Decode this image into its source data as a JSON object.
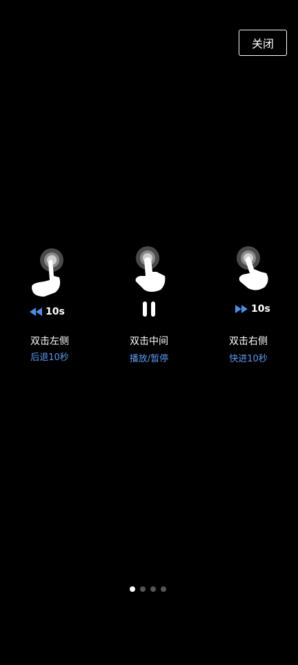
{
  "close_label": "关闭",
  "gestures": [
    {
      "indicator": "10s",
      "title": "双击左侧",
      "subtitle": "后退10秒",
      "icon": "rewind-icon"
    },
    {
      "indicator": "",
      "title": "双击中间",
      "subtitle": "播放/暂停",
      "icon": "pause-icon"
    },
    {
      "indicator": "10s",
      "title": "双击右侧",
      "subtitle": "快进10秒",
      "icon": "fast-forward-icon"
    }
  ],
  "pagination": {
    "total": 4,
    "active": 1
  },
  "colors": {
    "accent": "#5b9bf0",
    "background": "#000000"
  }
}
